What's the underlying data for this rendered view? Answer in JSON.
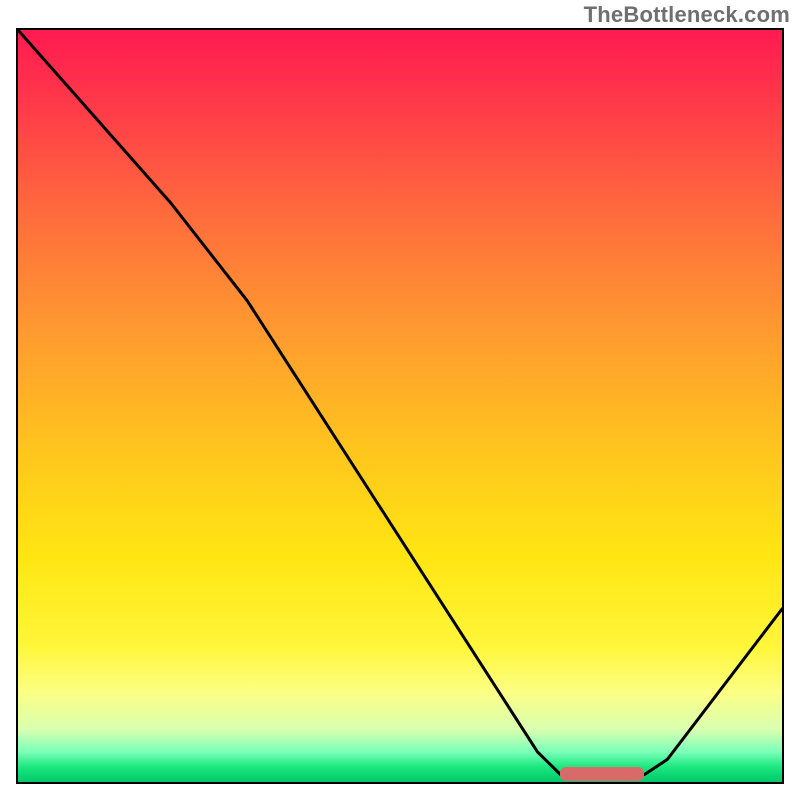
{
  "watermark": "TheBottleneck.com",
  "chart_data": {
    "type": "line",
    "title": "",
    "xlabel": "",
    "ylabel": "",
    "series": [
      {
        "name": "curve",
        "points": [
          {
            "x": 0.0,
            "y": 1.0
          },
          {
            "x": 0.2,
            "y": 0.77
          },
          {
            "x": 0.3,
            "y": 0.64
          },
          {
            "x": 0.68,
            "y": 0.04
          },
          {
            "x": 0.71,
            "y": 0.01
          },
          {
            "x": 0.82,
            "y": 0.01
          },
          {
            "x": 0.85,
            "y": 0.03
          },
          {
            "x": 1.0,
            "y": 0.23
          }
        ]
      }
    ],
    "marker": {
      "x_start": 0.71,
      "x_end": 0.82,
      "y": 0.01,
      "color": "#d86a6a"
    },
    "background": {
      "type": "gradient",
      "direction": "vertical",
      "stops": [
        {
          "pos": 0.0,
          "color": "#ff1a50"
        },
        {
          "pos": 0.5,
          "color": "#ffc31e"
        },
        {
          "pos": 0.85,
          "color": "#fff63a"
        },
        {
          "pos": 1.0,
          "color": "#00c86a"
        }
      ]
    }
  }
}
